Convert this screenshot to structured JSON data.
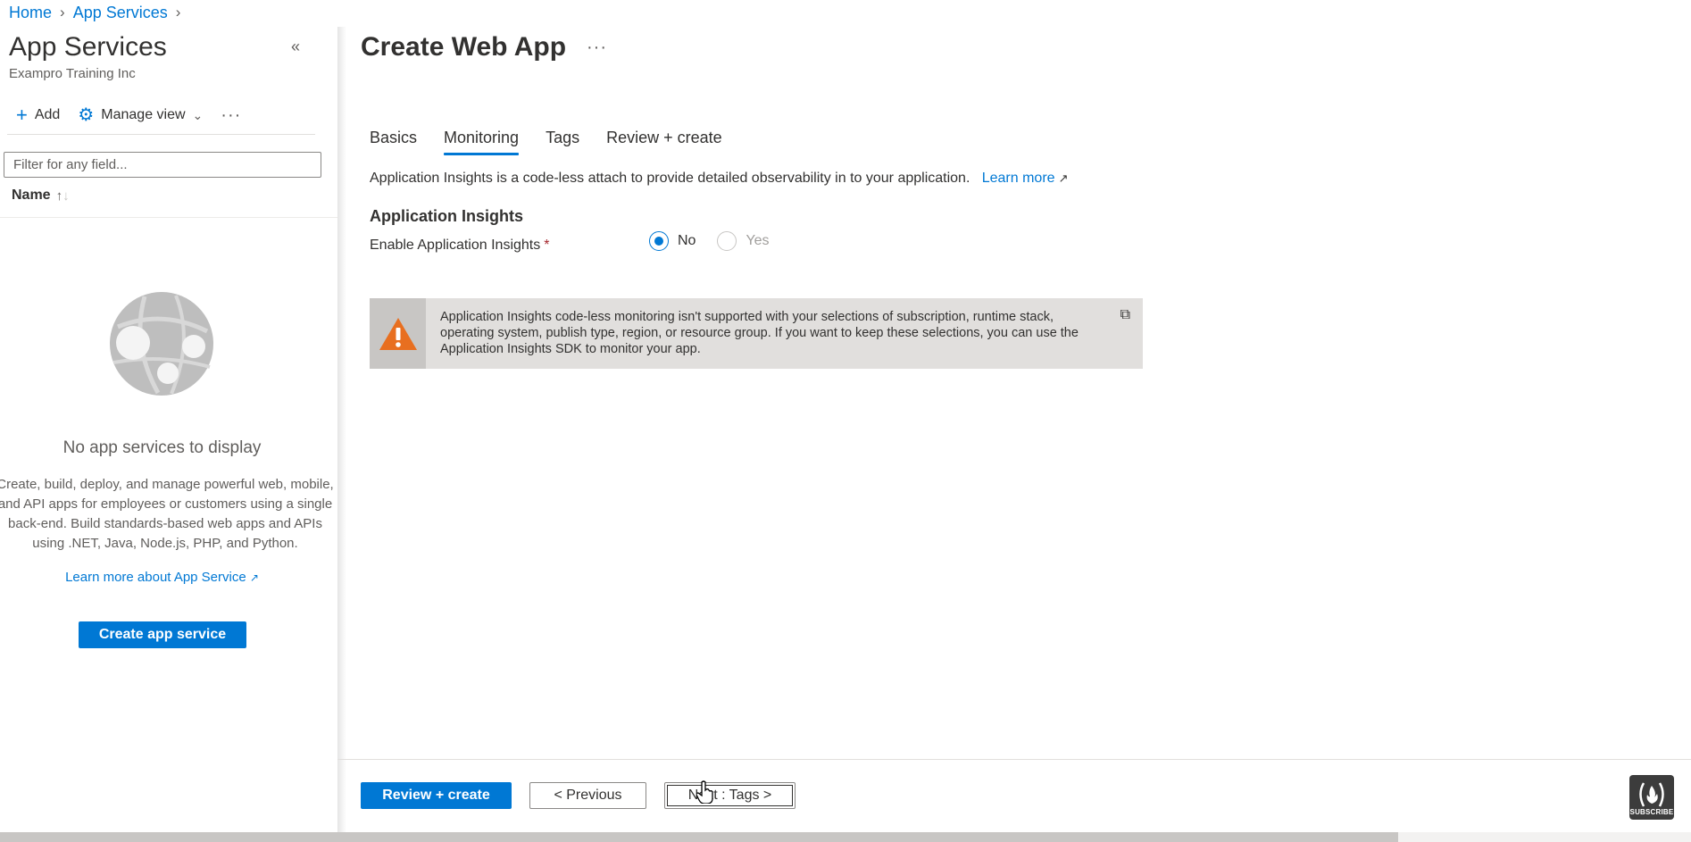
{
  "breadcrumb": {
    "items": [
      "Home",
      "App Services"
    ]
  },
  "left_blade": {
    "title": "App Services",
    "subtitle": "Exampro Training Inc",
    "collapse_icon": "chevron-double-left-icon",
    "commands": {
      "add": "Add",
      "manage_view": "Manage view",
      "more": "···"
    },
    "filter_placeholder": "Filter for any field...",
    "column_header": "Name",
    "empty_title": "No app services to display",
    "empty_desc_lines": [
      "Create, build, deploy, and manage powerful web, mobile,",
      "and API apps for employees or customers using a single",
      "back-end. Build standards-based web apps and APIs",
      "using .NET, Java, Node.js, PHP, and Python."
    ],
    "learn_more": "Learn more about App Service",
    "create_button": "Create app service"
  },
  "main": {
    "title": "Create Web App",
    "more": "···",
    "tabs": [
      {
        "label": "Basics",
        "active": false
      },
      {
        "label": "Monitoring",
        "active": true
      },
      {
        "label": "Tags",
        "active": false
      },
      {
        "label": "Review + create",
        "active": false
      }
    ],
    "intro_text": "Application Insights is a code-less attach to provide detailed observability in to your application.",
    "learn_more": "Learn more",
    "section_heading": "Application Insights",
    "field_label": "Enable Application Insights",
    "required_mark": "*",
    "radio_options": [
      {
        "label": "No",
        "selected": true,
        "enabled": true
      },
      {
        "label": "Yes",
        "selected": false,
        "enabled": false
      }
    ],
    "warning": {
      "icon": "warning-triangle-icon",
      "text": "Application Insights code-less monitoring isn't supported with your selections of subscription, runtime stack, operating system, publish type, region, or resource group. If you want to keep these selections, you can use the Application Insights SDK to monitor your app."
    }
  },
  "footer": {
    "review_create": "Review + create",
    "previous": "< Previous",
    "next": "Next : Tags >"
  },
  "overlay": {
    "subscribe_label": "SUBSCRIBE"
  },
  "colors": {
    "accent": "#0078d4",
    "warning_orange": "#e86f20",
    "required_red": "#a4262c"
  }
}
